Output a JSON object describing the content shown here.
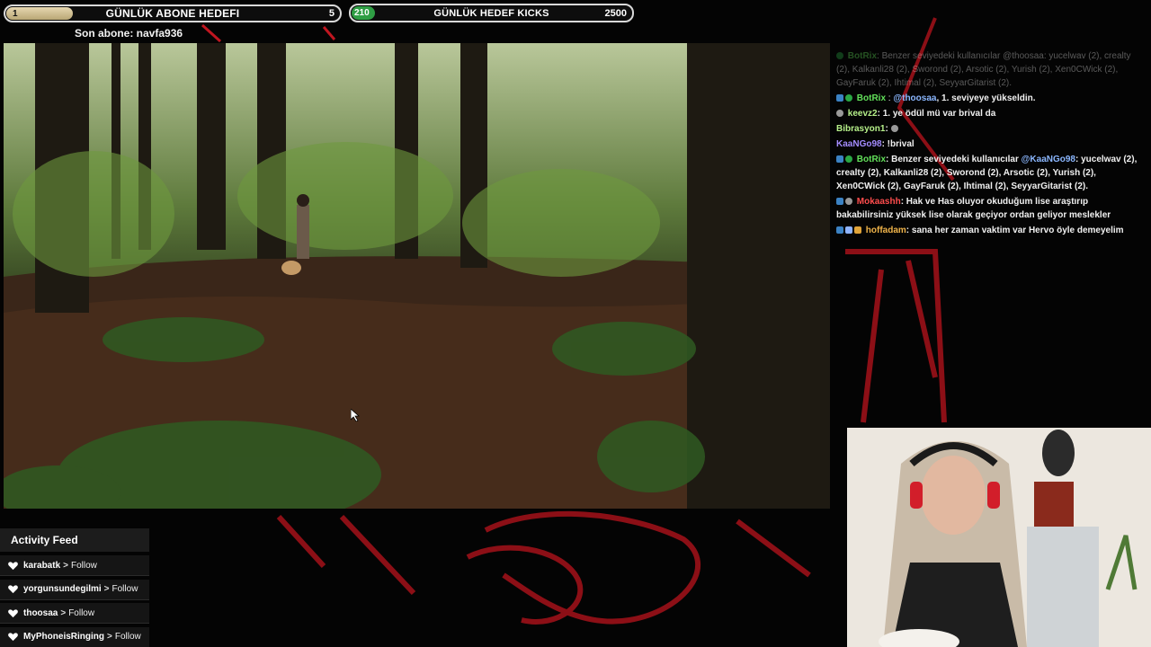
{
  "goals": {
    "abone": {
      "start": "1",
      "title": "GÜNLÜK ABONE HEDEFI",
      "end": "5",
      "progress": 0.2
    },
    "kicks": {
      "start": "210",
      "title": "GÜNLÜK HEDEF KICKS",
      "end": "2500",
      "progress": 0.084
    },
    "last_sub": "Son abone: navfa936"
  },
  "chat": {
    "messages": [
      {
        "user": "BotRix",
        "text": ": Benzer seviyedeki kullanıcılar @thoosaa: yucelwav (2), crealty (2), Kalkanli28 (2), Sworond (2), Arsotic (2), Yurish (2), Xen0CWick (2), GayFaruk (2), Ihtimal (2), SeyyarGitarist (2)."
      },
      {
        "user": "BotRix",
        "mention": "@thoosaa",
        "text": ", 1. seviyeye yükseldin."
      },
      {
        "user": "keevz2",
        "text": ": 1. ye ödül mü var brival da"
      },
      {
        "user": "Bibrasyon1",
        "text": ":"
      },
      {
        "user": "KaaNGo98",
        "text": ": !brival"
      },
      {
        "user": "BotRix",
        "text": ": Benzer seviyedeki kullanıcılar",
        "mention": "@KaaNGo98",
        "text2": ": yucelwav (2), crealty (2), Kalkanli28 (2), Sworond (2), Arsotic (2), Yurish (2), Xen0CWick (2), GayFaruk (2), Ihtimal (2), SeyyarGitarist (2)."
      },
      {
        "user": "Mokaashh",
        "text": ": Hak ve Has oluyor okuduğum lise araştırıp bakabilirsiniz yüksek lise olarak geçiyor ordan geliyor meslekler"
      },
      {
        "user": "hoffadam",
        "text": ": sana her zaman vaktim var Hervo öyle demeyelim"
      }
    ]
  },
  "feed": {
    "title": "Activity Feed",
    "items": [
      {
        "user": "karabatk",
        "action": "Follow"
      },
      {
        "user": "yorgunsundegilmi",
        "action": "Follow"
      },
      {
        "user": "thoosaa",
        "action": "Follow"
      },
      {
        "user": "MyPhoneisRinging",
        "action": "Follow"
      }
    ],
    "arrow": ">"
  },
  "colors": {
    "accent_red": "#b3121b",
    "bot_green": "#62e05a"
  }
}
